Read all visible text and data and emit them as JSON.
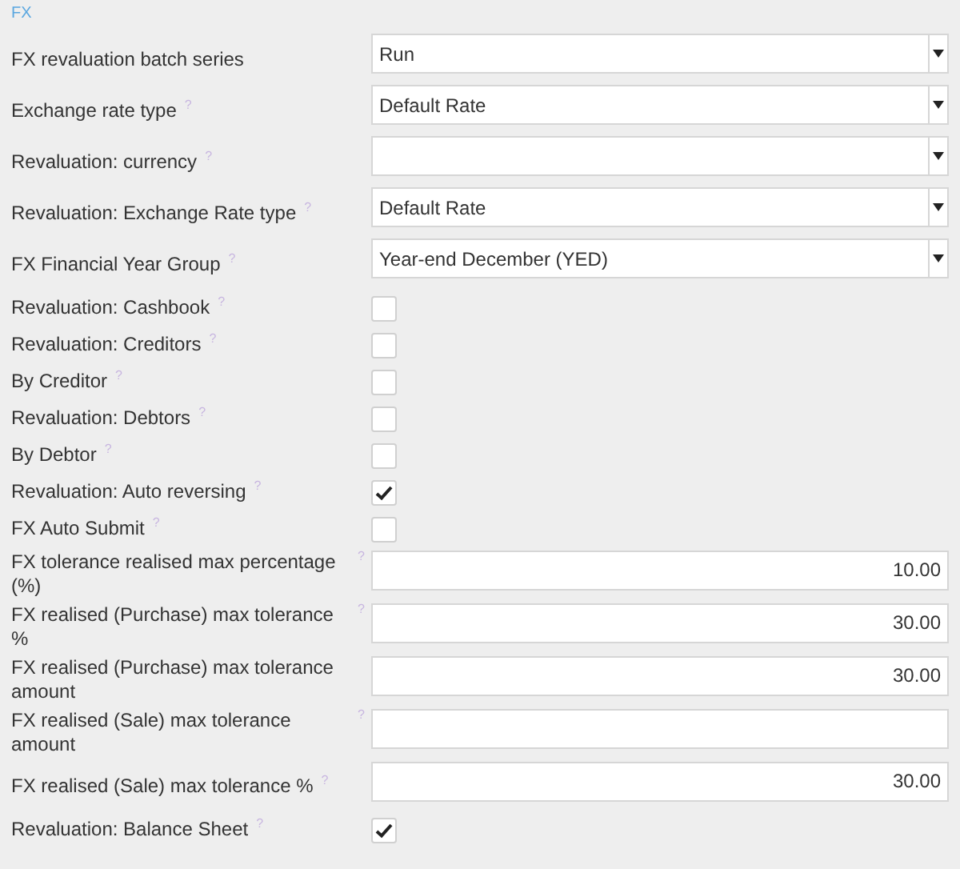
{
  "section": {
    "title": "FX"
  },
  "rows": [
    {
      "kind": "select",
      "label": "FX revaluation batch series",
      "value": "Run"
    },
    {
      "kind": "select",
      "label": "Exchange rate type",
      "help": "?",
      "value": "Default Rate"
    },
    {
      "kind": "select",
      "label": "Revaluation: currency",
      "help": "?"
    },
    {
      "kind": "select",
      "label": "Revaluation: Exchange Rate type",
      "help": "?",
      "value": "Default Rate"
    },
    {
      "kind": "select",
      "label": "FX Financial Year Group",
      "help": "?",
      "value": "Year-end December (YED)"
    },
    {
      "kind": "checkbox",
      "label": "Revaluation: Cashbook",
      "help": "?",
      "checked": false
    },
    {
      "kind": "checkbox",
      "label": "Revaluation: Creditors",
      "help": "?",
      "checked": false
    },
    {
      "kind": "checkbox",
      "label": "By Creditor",
      "help": "?",
      "checked": false
    },
    {
      "kind": "checkbox",
      "label": "Revaluation: Debtors",
      "help": "?",
      "checked": false
    },
    {
      "kind": "checkbox",
      "label": "By Debtor",
      "help": "?",
      "checked": false
    },
    {
      "kind": "checkbox",
      "label": "Revaluation: Auto reversing",
      "help": "?",
      "checked": true
    },
    {
      "kind": "checkbox",
      "label": "FX Auto Submit",
      "help": "?",
      "checked": false
    },
    {
      "kind": "number",
      "label": "FX tolerance realised max percentage (%)",
      "help": "?",
      "value": "10.00"
    },
    {
      "kind": "number",
      "label": "FX realised (Purchase) max tolerance %",
      "help": "?",
      "value": "30.00"
    },
    {
      "kind": "number",
      "label": "FX realised (Purchase) max tolerance amount",
      "value": "30.00"
    },
    {
      "kind": "number",
      "label": "FX realised (Sale) max tolerance amount",
      "help": "?"
    },
    {
      "kind": "number",
      "label": "FX realised (Sale) max tolerance %",
      "help": "?",
      "value": "30.00"
    },
    {
      "kind": "checkbox",
      "label": "Revaluation: Balance Sheet",
      "help": "?",
      "checked": true
    }
  ]
}
